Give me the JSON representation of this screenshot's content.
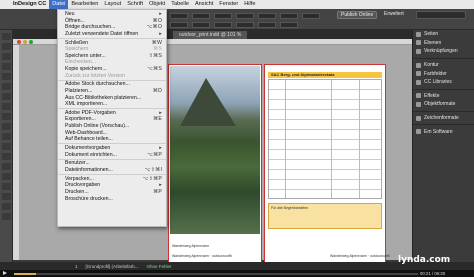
{
  "menubar": {
    "app": "InDesign CC",
    "items": [
      "Datei",
      "Bearbeiten",
      "Layout",
      "Schrift",
      "Objekt",
      "Tabelle",
      "Ansicht",
      "Fenster",
      "Hilfe"
    ],
    "active_index": 0
  },
  "controlbar": {
    "publish_online": "Publish Online",
    "workspace": "Erweitert"
  },
  "document_tab": "outdoor_print.indd @ 101 %",
  "file_menu": [
    {
      "label": "Neu",
      "shortcut": "",
      "submenu": true
    },
    {
      "label": "Öffnen...",
      "shortcut": "⌘O"
    },
    {
      "label": "Bridge durchsuchen...",
      "shortcut": "⌥⌘O"
    },
    {
      "label": "Zuletzt verwendete Datei öffnen",
      "shortcut": "",
      "submenu": true
    },
    {
      "sep": true
    },
    {
      "label": "Schließen",
      "shortcut": "⌘W"
    },
    {
      "label": "Speichern",
      "shortcut": "⌘S",
      "disabled": true
    },
    {
      "label": "Speichern unter...",
      "shortcut": "⇧⌘S"
    },
    {
      "label": "Einchecken...",
      "shortcut": "",
      "disabled": true
    },
    {
      "label": "Kopie speichern...",
      "shortcut": "⌥⌘S"
    },
    {
      "label": "Zurück zur letzten Version",
      "shortcut": "",
      "disabled": true
    },
    {
      "sep": true
    },
    {
      "label": "Adobe Stock durchsuchen...",
      "shortcut": ""
    },
    {
      "label": "Platzieren...",
      "shortcut": "⌘D"
    },
    {
      "label": "Aus CC-Bibliotheken platzieren...",
      "shortcut": ""
    },
    {
      "label": "XML importieren...",
      "shortcut": ""
    },
    {
      "sep": true
    },
    {
      "label": "Adobe PDF-Vorgaben",
      "shortcut": "",
      "submenu": true
    },
    {
      "label": "Exportieren...",
      "shortcut": "⌘E"
    },
    {
      "label": "Publish Online (Vorschau)...",
      "shortcut": ""
    },
    {
      "label": "Web-Dashboard...",
      "shortcut": ""
    },
    {
      "label": "Auf Behance teilen...",
      "shortcut": ""
    },
    {
      "sep": true
    },
    {
      "label": "Dokumentvorgaben",
      "shortcut": "",
      "submenu": true
    },
    {
      "label": "Dokument einrichten...",
      "shortcut": "⌥⌘P"
    },
    {
      "sep": true
    },
    {
      "label": "Benutzer...",
      "shortcut": ""
    },
    {
      "label": "Dateiinformationen...",
      "shortcut": "⌥⇧⌘I"
    },
    {
      "sep": true
    },
    {
      "label": "Verpacken...",
      "shortcut": "⌥⇧⌘P"
    },
    {
      "label": "Druckvorgaben",
      "shortcut": "",
      "submenu": true
    },
    {
      "label": "Drucken...",
      "shortcut": "⌘P"
    },
    {
      "label": "Broschüre drucken...",
      "shortcut": ""
    }
  ],
  "panels": [
    {
      "label": "Seiten"
    },
    {
      "label": "Ebenen"
    },
    {
      "label": "Verknüpfungen"
    },
    {
      "gap": true
    },
    {
      "label": "Kontur"
    },
    {
      "label": "Farbfelder"
    },
    {
      "label": "CC Libraries"
    },
    {
      "gap": true
    },
    {
      "label": "Effekte"
    },
    {
      "label": "Objektformate"
    },
    {
      "gap": true
    },
    {
      "label": "Zeichenformate"
    },
    {
      "gap": true
    },
    {
      "label": "Em Software"
    }
  ],
  "page_content": {
    "table_title": "SAC Berg- und Alpinwanderskala",
    "legend": "Für alle Begehbarkeiten",
    "caption_left": "Wanderweg Alpenrosen",
    "footer_left": "Wanderweg Alpenrosen · outdooroutfit",
    "footer_right": "Wanderweg Alpenrosen · outdooroutfit"
  },
  "statusbar": {
    "page": "1",
    "doc": "[Grundprofil] (Arbeitsfarb...",
    "status": "Ohne Fehler"
  },
  "player": {
    "timecode": "00:21 / 06:30",
    "progress": 0.054
  },
  "branding": "lynda.com"
}
